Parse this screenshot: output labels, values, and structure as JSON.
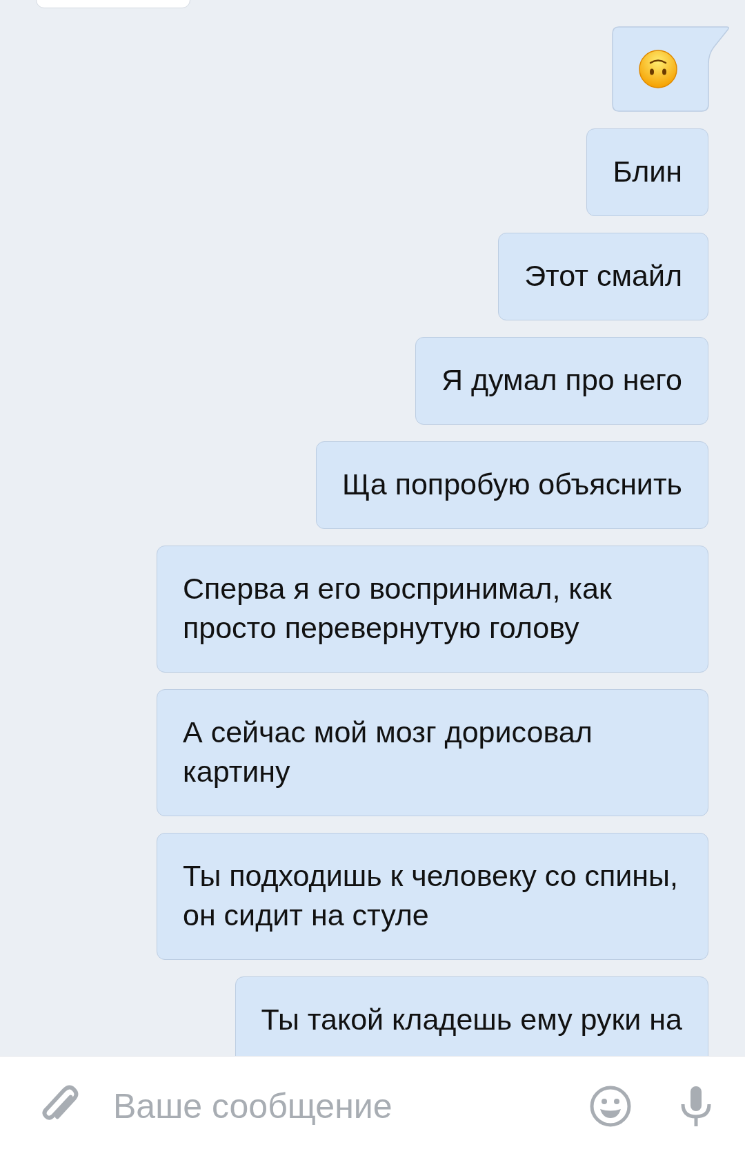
{
  "messages": [
    {
      "kind": "incoming_blank"
    },
    {
      "kind": "emoji"
    },
    {
      "kind": "text",
      "text": "Блин"
    },
    {
      "kind": "text",
      "text": "Этот смайл"
    },
    {
      "kind": "text",
      "text": "Я думал про него"
    },
    {
      "kind": "text",
      "text": "Ща попробую объяснить"
    },
    {
      "kind": "text",
      "text": "Сперва я его воспринимал, как просто перевернутую голову"
    },
    {
      "kind": "text",
      "text": "А сейчас мой мозг дорисовал картину"
    },
    {
      "kind": "text",
      "text": "Ты подходишь к человеку со спины, он сидит на стуле"
    },
    {
      "kind": "text",
      "text": "Ты такой кладешь ему руки на"
    }
  ],
  "composer": {
    "placeholder": "Ваше сообщение"
  }
}
